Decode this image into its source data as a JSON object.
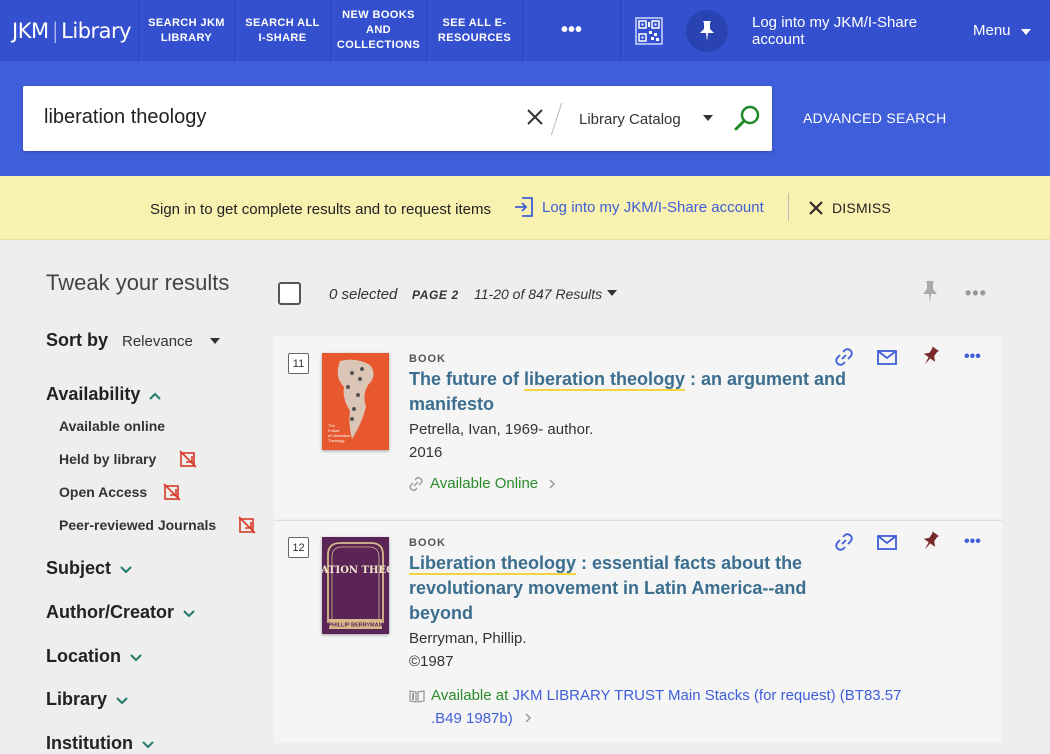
{
  "nav": {
    "brand_left": "JKM",
    "brand_right": "Library",
    "links": [
      "SEARCH JKM LIBRARY",
      "SEARCH ALL I-SHARE",
      "NEW BOOKS AND COLLECTIONS",
      "SEE ALL E-RESOURCES"
    ],
    "more": "•••",
    "login": "Log into my JKM/I-Share account",
    "menu": "Menu"
  },
  "search": {
    "query": "liberation theology",
    "scope": "Library Catalog",
    "advanced": "ADVANCED SEARCH"
  },
  "banner": {
    "message": "Sign in to get complete results and to request items",
    "login": "Log into my JKM/I-Share account",
    "dismiss": "DISMISS"
  },
  "sidebar": {
    "title": "Tweak your results",
    "sort_label": "Sort by",
    "sort_value": "Relevance",
    "availability": "Availability",
    "availability_items": [
      "Available online",
      "Held by library",
      "Open Access",
      "Peer-reviewed Journals"
    ],
    "facets": [
      "Subject",
      "Author/Creator",
      "Location",
      "Library",
      "Institution"
    ]
  },
  "toolbar": {
    "selected": "0 selected",
    "page": "PAGE 2",
    "range": "11-20 of 847 Results"
  },
  "results": [
    {
      "num": "11",
      "type": "BOOK",
      "title_hl": "liberation theology",
      "title_pre": "The future of ",
      "title_post": " : an argument and manifesto",
      "author": "Petrella, Ivan, 1969- author.",
      "date": "2016",
      "availability": "Available Online",
      "cover_title": "The Future of Liberation Theology"
    },
    {
      "num": "12",
      "type": "BOOK",
      "title_hl": "Liberation theology",
      "title_post": " : essential facts about the revolutionary movement in Latin America--and beyond",
      "author": "Berryman, Phillip.",
      "date": "©1987",
      "avail_prefix": "Available at",
      "location": "JKM LIBRARY TRUST  Main Stacks (for request) (BT83.57 .B49 1987b)",
      "cover_title": "LIBERATION THEOLOGY",
      "cover_author": "PHILLIP BERRYMAN"
    }
  ],
  "colors": {
    "nav": "#3450cf",
    "search_band": "#3f5ed9",
    "banner": "#f8f1b0",
    "title_link": "#3b6e8f",
    "available": "#2a8a2a",
    "pin": "#7a2a2a"
  }
}
